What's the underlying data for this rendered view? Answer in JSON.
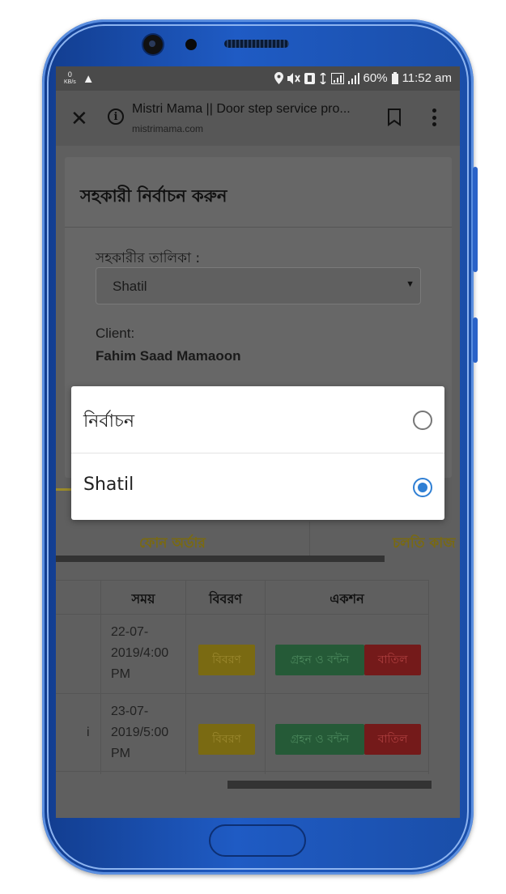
{
  "statusbar": {
    "net_speed_top": "0",
    "net_speed_unit": "KB/s",
    "warning": "▲",
    "battery": "60%",
    "time": "11:52 am"
  },
  "toolbar": {
    "title": "Mistri Mama || Door step service pro...",
    "domain": "mistrimama.com"
  },
  "modal": {
    "title": "সহকারী নির্বাচন করুন",
    "field_label": "সহকারীর তালিকা :",
    "select_value": "Shatil",
    "client_label": "Client:",
    "client_name": "Fahim Saad Mamaoon"
  },
  "tabs": [
    {
      "label": "ফোন অর্ডার"
    },
    {
      "label": "চলতি কাজ"
    }
  ],
  "table": {
    "headers": [
      "সময়",
      "বিবরণ",
      "একশন"
    ],
    "rows": [
      {
        "time_lines": [
          "22-07-",
          "2019/4:00",
          "PM"
        ],
        "details": "বিবরণ",
        "accept": "গ্রহন ও বন্টন",
        "cancel": "বাতিল"
      },
      {
        "lead": "i",
        "time_lines": [
          "23-07-",
          "2019/5:00",
          "PM"
        ],
        "details": "বিবরণ",
        "accept": "গ্রহন ও বন্টন",
        "cancel": "বাতিল"
      }
    ]
  },
  "dialog": {
    "options": [
      {
        "label": "নির্বাচন",
        "selected": false
      },
      {
        "label": "Shatil",
        "selected": true
      }
    ]
  },
  "colors": {
    "radio_accent": "#2f7fd4",
    "phone_body": "#1f5bc4"
  }
}
